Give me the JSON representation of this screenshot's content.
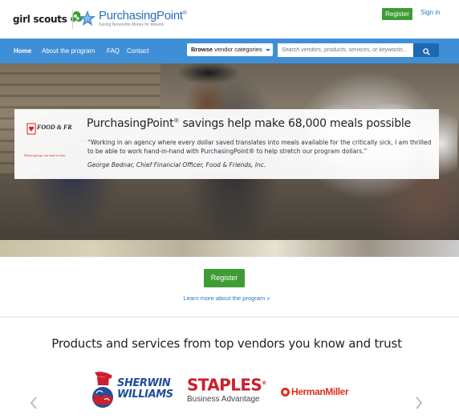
{
  "header": {
    "girl_scouts_logo": "girl scouts",
    "purchasingpoint_logo": "PurchasingPoint",
    "purchasingpoint_reg": "®",
    "purchasingpoint_tagline": "Saving Nonprofits Money for Mission",
    "register_label": "Register",
    "signin_label": "Sign in"
  },
  "nav": {
    "items": [
      "Home",
      "About the program",
      "FAQ",
      "Contact"
    ],
    "browse_bold": "Browse",
    "browse_rest": "vendor categories",
    "search_placeholder": "Search vendors, products, services, or keywords..."
  },
  "hero": {
    "partner_logo": "FOOD & FRIENDS",
    "partner_tagline": "Delivering hope, one meal at a time",
    "title_pre": "PurchasingPoint",
    "title_reg": "®",
    "title_post": " savings help make 68,000 meals possible",
    "quote": "“Working in an agency where every dollar saved translates into meals available for the critically sick, I am thrilled to be able to work hand-in-hand with PurchasingPoint® to help stretch our program dollars.”",
    "attribution": "George Bednar, Chief Financial Officer, Food & Friends, Inc."
  },
  "cta": {
    "register_label": "Register",
    "learn_more": "Learn more about the program »"
  },
  "vendors": {
    "heading": "Products and services from top vendors you know and trust",
    "sherwin_line1": "SHERWIN",
    "sherwin_line2": "WILLIAMS",
    "staples_word": "STAPLES",
    "staples_sub": "Business Advantage",
    "staples_mark": "®",
    "hermanmiller": "HermanMiller"
  },
  "colors": {
    "brand_green": "#3f9c35",
    "nav_blue": "#3f8fd7",
    "link_blue": "#2b78c2",
    "staples_red": "#cc1f2d",
    "sherwin_blue": "#1e4f9c"
  }
}
